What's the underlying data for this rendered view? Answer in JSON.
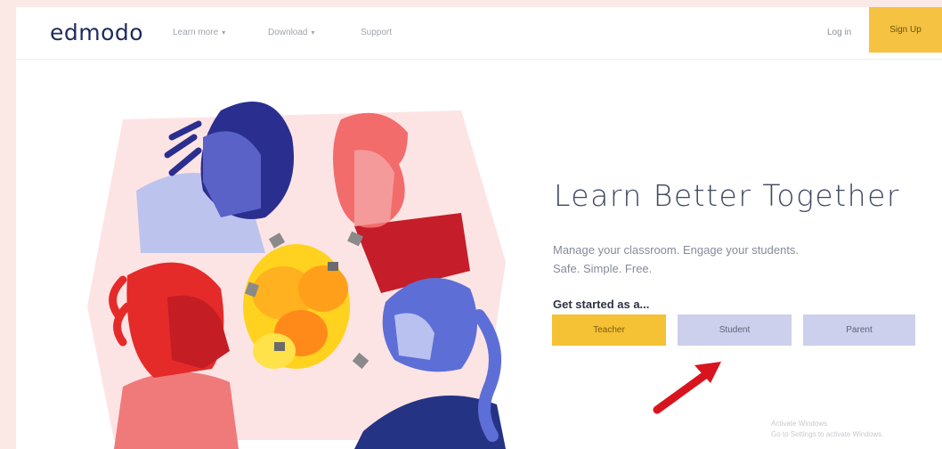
{
  "nav": {
    "logo": "edmodo",
    "links": [
      "Learn more",
      "Download",
      "Support"
    ],
    "login": "Log in",
    "signup": "Sign Up"
  },
  "hero": {
    "headline": "Learn Better Together",
    "subtitle_line1": "Manage your classroom. Engage your students.",
    "subtitle_line2": "Safe. Simple. Free.",
    "get_started": "Get started as a...",
    "buttons": {
      "teacher": "Teacher",
      "student": "Student",
      "parent": "Parent"
    }
  },
  "watermark": {
    "line1": "Activate Windows",
    "line2": "Go to Settings to activate Windows."
  },
  "colors": {
    "accent_yellow": "#f5c242",
    "navy": "#1d2b5c",
    "lavender": "#ccd0ec",
    "red_arrow": "#d8141f"
  },
  "icons": {
    "arrow": "red-arrow-pointer",
    "chevron": "chevron-down-icon"
  }
}
